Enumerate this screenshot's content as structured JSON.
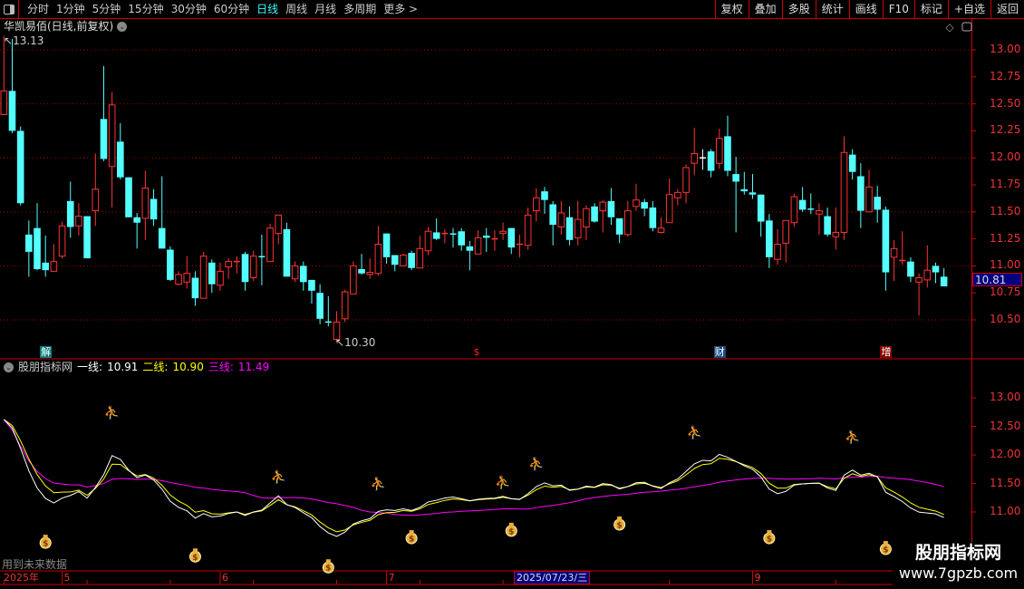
{
  "toolbar": {
    "periods": [
      "分时",
      "1分钟",
      "5分钟",
      "15分钟",
      "30分钟",
      "60分钟",
      "日线",
      "周线",
      "月线",
      "多周期",
      "更多 >"
    ],
    "active_period": "日线",
    "right_buttons": [
      "复权",
      "叠加",
      "多股",
      "统计",
      "画线",
      "F10",
      "标记",
      "+自选",
      "返回"
    ]
  },
  "main_chart": {
    "title": "华凯易佰(日线,前复权)",
    "high_label": "13.13",
    "low_label": "10.30",
    "last_price": "10.81",
    "y_ticks": [
      "13.00",
      "12.75",
      "12.50",
      "12.25",
      "12.00",
      "11.75",
      "11.50",
      "11.25",
      "11.00",
      "10.75",
      "10.50"
    ],
    "events": [
      {
        "label": "解",
        "candle": 6,
        "bg": "#0a7a7a",
        "fg": "#fff"
      },
      {
        "label": "$",
        "candle": 58,
        "bg": "#000",
        "fg": "#f22"
      },
      {
        "label": "财",
        "candle": 87,
        "bg": "#1a4a7a",
        "fg": "#fff"
      },
      {
        "label": "增",
        "candle": 107,
        "bg": "#8a0000",
        "fg": "#fff"
      }
    ]
  },
  "indicator": {
    "name": "股朋指标网",
    "line1_label": "一线:",
    "line1_value": "10.91",
    "line2_label": "二线:",
    "line2_value": "10.90",
    "line3_label": "三线:",
    "line3_value": "11.49",
    "y_ticks": [
      "13.00",
      "12.50",
      "12.00",
      "11.50",
      "11.00"
    ],
    "note": "用到未来数据",
    "colors": {
      "line1": "#ffffff",
      "line2": "#ffff00",
      "line3": "#ff00ff"
    },
    "runner_markers": [
      {
        "candle": 14,
        "value": 12.75
      },
      {
        "candle": 34,
        "value": 11.62
      },
      {
        "candle": 46,
        "value": 11.5
      },
      {
        "candle": 61,
        "value": 11.52
      },
      {
        "candle": 65,
        "value": 11.85
      },
      {
        "candle": 84,
        "value": 12.4
      },
      {
        "candle": 103,
        "value": 12.32
      }
    ],
    "money_markers": [
      {
        "candle": 6,
        "value": 10.49
      },
      {
        "candle": 24,
        "value": 10.25
      },
      {
        "candle": 40,
        "value": 10.06
      },
      {
        "candle": 50,
        "value": 10.57
      },
      {
        "candle": 62,
        "value": 10.7
      },
      {
        "candle": 75,
        "value": 10.81
      },
      {
        "candle": 93,
        "value": 10.57
      },
      {
        "candle": 107,
        "value": 10.38
      }
    ]
  },
  "time_axis": {
    "year": "2025年",
    "months": [
      {
        "label": "5",
        "candle": 8
      },
      {
        "label": "6",
        "candle": 27
      },
      {
        "label": "7",
        "candle": 47
      },
      {
        "label": "9",
        "candle": 91
      }
    ],
    "cursor_date": "2025/07/23/三"
  },
  "watermark": {
    "line1": "股朋指标网",
    "line2": "www.7gpzb.com"
  },
  "chart_data": {
    "type": "candlestick",
    "colors": {
      "up": "#ff3333",
      "down": "#54ffff"
    },
    "fields": [
      "open",
      "high",
      "low",
      "close"
    ],
    "candles": [
      [
        12.4,
        13.13,
        12.4,
        12.62
      ],
      [
        12.62,
        13.1,
        12.23,
        12.25
      ],
      [
        12.25,
        12.29,
        11.56,
        11.58
      ],
      [
        11.29,
        11.42,
        10.9,
        11.13
      ],
      [
        11.35,
        11.58,
        10.96,
        10.97
      ],
      [
        11.03,
        11.28,
        10.9,
        10.96
      ],
      [
        10.95,
        11.2,
        10.95,
        11.04
      ],
      [
        11.09,
        11.41,
        11.07,
        11.37
      ],
      [
        11.6,
        11.78,
        11.26,
        11.36
      ],
      [
        11.37,
        11.58,
        11.28,
        11.46
      ],
      [
        11.46,
        11.46,
        11.07,
        11.07
      ],
      [
        11.51,
        12.04,
        11.37,
        11.71
      ],
      [
        12.36,
        12.85,
        11.97,
        11.99
      ],
      [
        11.92,
        12.61,
        11.54,
        12.49
      ],
      [
        12.15,
        12.32,
        11.8,
        11.82
      ],
      [
        11.82,
        11.82,
        11.45,
        11.45
      ],
      [
        11.45,
        11.49,
        11.16,
        11.4
      ],
      [
        11.44,
        11.88,
        11.24,
        11.72
      ],
      [
        11.62,
        11.71,
        11.37,
        11.43
      ],
      [
        11.35,
        11.83,
        11.16,
        11.16
      ],
      [
        11.15,
        11.18,
        10.86,
        10.87
      ],
      [
        10.83,
        10.95,
        10.82,
        10.92
      ],
      [
        10.85,
        11.09,
        10.79,
        10.93
      ],
      [
        10.89,
        10.95,
        10.63,
        10.7
      ],
      [
        10.7,
        11.13,
        10.7,
        11.09
      ],
      [
        11.03,
        11.06,
        10.75,
        10.83
      ],
      [
        10.82,
        11.03,
        10.77,
        10.95
      ],
      [
        10.99,
        11.07,
        10.88,
        11.04
      ],
      [
        11.04,
        11.09,
        10.93,
        11.04
      ],
      [
        11.11,
        11.13,
        10.77,
        10.85
      ],
      [
        10.89,
        11.14,
        10.86,
        11.09
      ],
      [
        11.085,
        11.29,
        10.82,
        11.08
      ],
      [
        11.04,
        11.39,
        11.04,
        11.35
      ],
      [
        11.3,
        11.47,
        11.2,
        11.47
      ],
      [
        11.34,
        11.4,
        10.9,
        10.9
      ],
      [
        10.88,
        11.04,
        10.85,
        11.0
      ],
      [
        11.0,
        11.04,
        10.77,
        10.85
      ],
      [
        10.87,
        10.87,
        10.65,
        10.77
      ],
      [
        10.75,
        10.83,
        10.46,
        10.51
      ],
      [
        10.48,
        10.72,
        10.44,
        10.47
      ],
      [
        10.32,
        10.58,
        10.3,
        10.48
      ],
      [
        10.51,
        10.78,
        10.48,
        10.76
      ],
      [
        10.74,
        11.04,
        10.74,
        11.0
      ],
      [
        10.97,
        11.11,
        10.92,
        10.93
      ],
      [
        10.92,
        11.07,
        10.88,
        10.94
      ],
      [
        10.93,
        11.37,
        10.91,
        11.2
      ],
      [
        11.3,
        11.3,
        11.02,
        11.08
      ],
      [
        11.1,
        11.1,
        10.95,
        11.01
      ],
      [
        11.0,
        11.11,
        11.0,
        11.1
      ],
      [
        11.12,
        11.14,
        10.96,
        10.98
      ],
      [
        10.98,
        11.28,
        10.98,
        11.16
      ],
      [
        11.14,
        11.36,
        11.1,
        11.32
      ],
      [
        11.31,
        11.44,
        11.24,
        11.25
      ],
      [
        11.3,
        11.34,
        11.21,
        11.3
      ],
      [
        11.295,
        11.35,
        11.17,
        11.29
      ],
      [
        11.32,
        11.35,
        11.14,
        11.19
      ],
      [
        11.18,
        11.23,
        10.96,
        11.14
      ],
      [
        11.11,
        11.33,
        11.11,
        11.26
      ],
      [
        11.28,
        11.35,
        11.13,
        11.26
      ],
      [
        11.25,
        11.33,
        11.14,
        11.25
      ],
      [
        11.3,
        11.4,
        11.24,
        11.32
      ],
      [
        11.35,
        11.35,
        11.11,
        11.17
      ],
      [
        11.2,
        11.29,
        11.08,
        11.2
      ],
      [
        11.19,
        11.54,
        11.15,
        11.47
      ],
      [
        11.51,
        11.72,
        11.41,
        11.63
      ],
      [
        11.69,
        11.73,
        11.48,
        11.61
      ],
      [
        11.57,
        11.6,
        11.19,
        11.38
      ],
      [
        11.36,
        11.6,
        11.29,
        11.49
      ],
      [
        11.45,
        11.55,
        11.19,
        11.24
      ],
      [
        11.26,
        11.6,
        11.19,
        11.43
      ],
      [
        11.36,
        11.56,
        11.24,
        11.53
      ],
      [
        11.55,
        11.58,
        11.4,
        11.41
      ],
      [
        11.51,
        11.61,
        11.31,
        11.59
      ],
      [
        11.6,
        11.72,
        11.38,
        11.45
      ],
      [
        11.44,
        11.44,
        11.21,
        11.29
      ],
      [
        11.29,
        11.6,
        11.27,
        11.51
      ],
      [
        11.55,
        11.76,
        11.51,
        11.61
      ],
      [
        11.59,
        11.62,
        11.46,
        11.53
      ],
      [
        11.54,
        11.6,
        11.32,
        11.35
      ],
      [
        11.31,
        11.45,
        11.3,
        11.35
      ],
      [
        11.4,
        11.81,
        11.4,
        11.66
      ],
      [
        11.63,
        11.71,
        11.56,
        11.68
      ],
      [
        11.68,
        11.94,
        11.58,
        11.91
      ],
      [
        11.95,
        12.28,
        11.84,
        12.04
      ],
      [
        12.0,
        12.08,
        11.89,
        12.0
      ],
      [
        12.06,
        12.08,
        11.82,
        11.88
      ],
      [
        11.95,
        12.27,
        11.9,
        12.18
      ],
      [
        12.2,
        12.39,
        11.83,
        11.88
      ],
      [
        11.85,
        12.01,
        11.31,
        11.78
      ],
      [
        11.71,
        11.87,
        11.66,
        11.69
      ],
      [
        11.68,
        11.85,
        11.62,
        11.66
      ],
      [
        11.66,
        11.66,
        11.27,
        11.41
      ],
      [
        11.42,
        11.48,
        10.98,
        11.08
      ],
      [
        11.06,
        11.34,
        11.01,
        11.2
      ],
      [
        11.21,
        11.42,
        11.03,
        11.42
      ],
      [
        11.4,
        11.67,
        11.36,
        11.64
      ],
      [
        11.61,
        11.73,
        11.5,
        11.52
      ],
      [
        11.525,
        11.67,
        11.48,
        11.52
      ],
      [
        11.48,
        11.58,
        11.29,
        11.51
      ],
      [
        11.46,
        11.54,
        11.27,
        11.29
      ],
      [
        11.27,
        11.54,
        11.15,
        11.31
      ],
      [
        11.31,
        12.2,
        11.24,
        12.05
      ],
      [
        12.03,
        12.08,
        11.8,
        11.87
      ],
      [
        11.83,
        11.95,
        11.35,
        11.51
      ],
      [
        11.5,
        11.89,
        11.5,
        11.73
      ],
      [
        11.64,
        11.74,
        11.4,
        11.52
      ],
      [
        11.52,
        11.55,
        10.77,
        10.94
      ],
      [
        11.08,
        11.24,
        10.86,
        11.16
      ],
      [
        11.05,
        11.32,
        11.01,
        11.05
      ],
      [
        11.04,
        11.08,
        10.85,
        10.9
      ],
      [
        10.85,
        10.93,
        10.54,
        10.89
      ],
      [
        10.87,
        11.19,
        10.8,
        10.96
      ],
      [
        11.0,
        11.03,
        10.84,
        10.94
      ],
      [
        10.9,
        10.98,
        10.81,
        10.81
      ]
    ],
    "white_doji_candles": [
      85
    ],
    "ylim_main": [
      10.3,
      13.2
    ],
    "ylim_indicator": [
      10.0,
      13.5
    ]
  }
}
